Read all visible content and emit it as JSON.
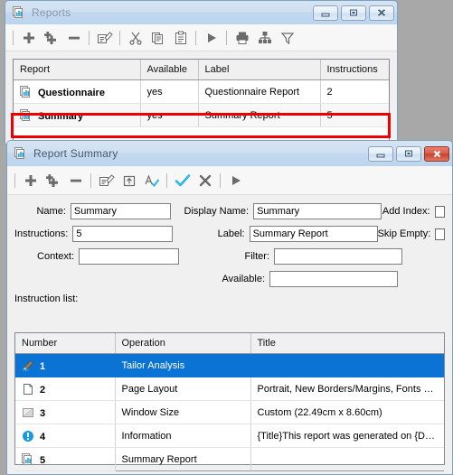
{
  "desktop": {
    "background_color": "#a8a8a8"
  },
  "reports_window": {
    "title": "Reports",
    "icon": "reports-icon",
    "window_buttons": {
      "minimize": "Minimize",
      "restore": "Restore",
      "close": "Close"
    },
    "toolbar": [
      {
        "name": "add",
        "icon": "plus-icon",
        "label": "Add"
      },
      {
        "name": "add-child",
        "icon": "plus-multi-icon",
        "label": "Add Child"
      },
      {
        "name": "remove",
        "icon": "minus-icon",
        "label": "Remove"
      },
      {
        "name": "edit",
        "icon": "edit-pencil-icon",
        "label": "Edit"
      },
      {
        "name": "cut",
        "icon": "scissors-icon",
        "label": "Cut"
      },
      {
        "name": "copy",
        "icon": "copy-icon",
        "label": "Copy"
      },
      {
        "name": "paste",
        "icon": "paste-icon",
        "label": "Paste"
      },
      {
        "name": "run",
        "icon": "play-icon",
        "label": "Run"
      },
      {
        "name": "print",
        "icon": "printer-icon",
        "label": "Print"
      },
      {
        "name": "hierarchy",
        "icon": "hierarchy-icon",
        "label": "Hierarchy"
      },
      {
        "name": "filter",
        "icon": "funnel-icon",
        "label": "Filter"
      }
    ],
    "table": {
      "columns": [
        "Report",
        "Available",
        "Label",
        "Instructions"
      ],
      "rows": [
        {
          "icon": "report-icon",
          "report": "Questionnaire",
          "available": "yes",
          "label": "Questionnaire Report",
          "instructions": "2",
          "selected": false
        },
        {
          "icon": "report-icon",
          "report": "Summary",
          "available": "yes",
          "label": "Summary Report",
          "instructions": "5",
          "selected": false
        }
      ]
    },
    "highlight": {
      "color": "#ee0000",
      "target_row": "Summary"
    }
  },
  "report_summary_window": {
    "title": "Report Summary",
    "icon": "reports-icon",
    "window_buttons": {
      "minimize": "Minimize",
      "restore": "Restore",
      "close": "Close"
    },
    "toolbar": [
      {
        "name": "add",
        "icon": "plus-icon",
        "label": "Add"
      },
      {
        "name": "add-child",
        "icon": "plus-multi-icon",
        "label": "Add Child"
      },
      {
        "name": "remove",
        "icon": "minus-icon",
        "label": "Remove"
      },
      {
        "name": "edit",
        "icon": "edit-pencil-icon",
        "label": "Edit"
      },
      {
        "name": "move-up",
        "icon": "move-up-folder-icon",
        "label": "Move Up"
      },
      {
        "name": "spellcheck",
        "icon": "spellcheck-icon",
        "label": "Spell Check"
      },
      {
        "name": "accept",
        "icon": "checkmark-icon",
        "label": "Accept"
      },
      {
        "name": "cancel",
        "icon": "cross-icon",
        "label": "Cancel"
      },
      {
        "name": "run",
        "icon": "play-icon",
        "label": "Run"
      }
    ],
    "form": {
      "name": {
        "label": "Name:",
        "value": "Summary"
      },
      "instructions": {
        "label": "Instructions:",
        "value": "5"
      },
      "context": {
        "label": "Context:",
        "value": ""
      },
      "display_name": {
        "label": "Display Name:",
        "value": "Summary"
      },
      "label_field": {
        "label": "Label:",
        "value": "Summary Report"
      },
      "filter": {
        "label": "Filter:",
        "value": ""
      },
      "available": {
        "label": "Available:",
        "value": ""
      },
      "add_index": {
        "label": "Add Index:",
        "checked": false
      },
      "skip_empty": {
        "label": "Skip Empty:",
        "checked": false
      }
    },
    "instruction_list": {
      "section_label": "Instruction list:",
      "columns": [
        "Number",
        "Operation",
        "Title"
      ],
      "selection_color": "#0a73d3",
      "rows": [
        {
          "icon": "tailor-analysis-icon",
          "number": "1",
          "operation": "Tailor Analysis",
          "title": "",
          "selected": true
        },
        {
          "icon": "page-icon",
          "number": "2",
          "operation": "Page Layout",
          "title": "Portrait, New Borders/Margins, Fonts ch…",
          "selected": false
        },
        {
          "icon": "window-size-icon",
          "number": "3",
          "operation": "Window Size",
          "title": "Custom (22.49cm x 8.60cm)",
          "selected": false
        },
        {
          "icon": "information-icon",
          "number": "4",
          "operation": "Information",
          "title": "{Title}This report was generated on {Dat…",
          "selected": false
        },
        {
          "icon": "report-icon",
          "number": "5",
          "operation": "Summary Report",
          "title": "",
          "selected": false
        }
      ]
    }
  }
}
